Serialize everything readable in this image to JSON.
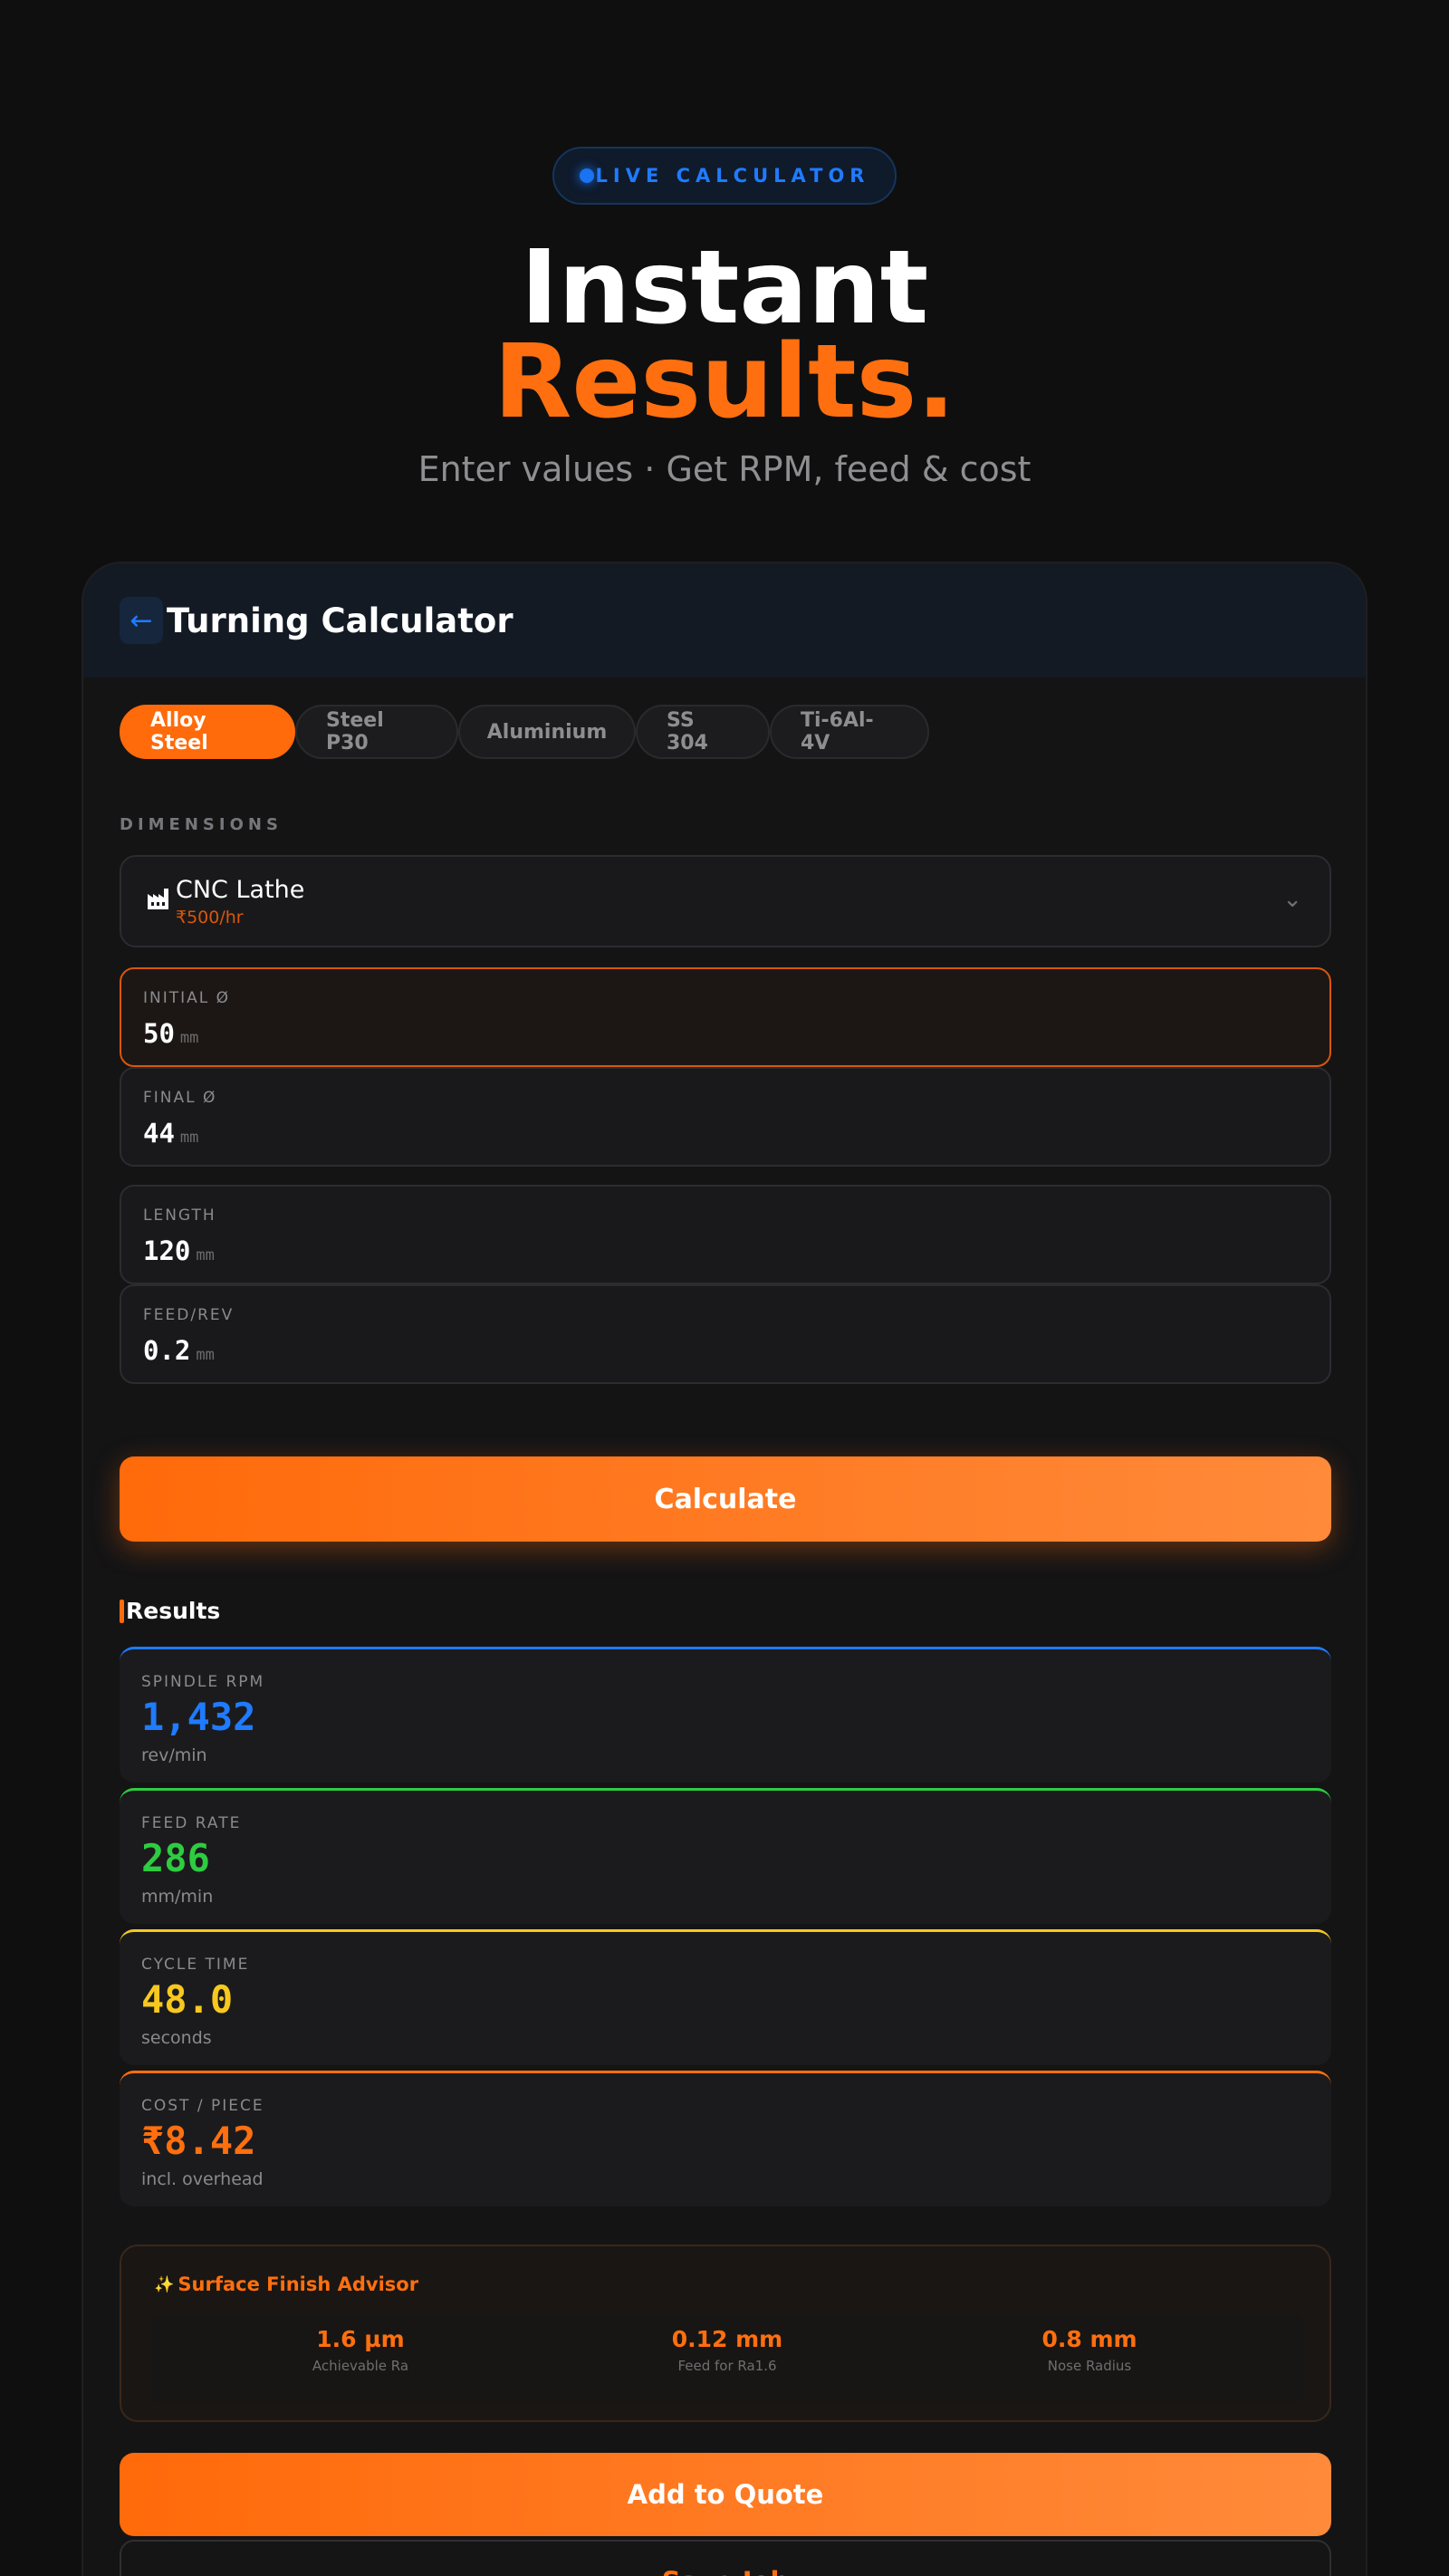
{
  "hero": {
    "badge": "LIVE CALCULATOR",
    "title_line1": "Instant",
    "title_line2": "Results.",
    "subtitle": "Enter values · Get RPM, feed & cost"
  },
  "card": {
    "back_icon": "←",
    "title": "Turning Calculator",
    "materials": [
      {
        "label": "Alloy Steel",
        "active": true
      },
      {
        "label": "Steel P30",
        "active": false
      },
      {
        "label": "Aluminium",
        "active": false
      },
      {
        "label": "SS 304",
        "active": false
      },
      {
        "label": "Ti-6Al-4V",
        "active": false
      }
    ],
    "section_label": "DIMENSIONS",
    "machine": {
      "icon": "factory-icon",
      "name": "CNC Lathe",
      "rate": "₹500/hr",
      "chevron": "⌄"
    },
    "fields": {
      "initial_diameter": {
        "label": "INITIAL Ø",
        "value": "50",
        "unit": "mm"
      },
      "final_diameter": {
        "label": "FINAL Ø",
        "value": "44",
        "unit": "mm"
      },
      "length": {
        "label": "LENGTH",
        "value": "120",
        "unit": "mm"
      },
      "feed_rev": {
        "label": "FEED/REV",
        "value": "0.2",
        "unit": "mm"
      }
    },
    "calculate_label": "Calculate",
    "results_title": "Results",
    "results": {
      "rpm": {
        "label": "SPINDLE RPM",
        "value": "1,432",
        "unit": "rev/min",
        "color": "#1f7bff"
      },
      "feed": {
        "label": "FEED RATE",
        "value": "286",
        "unit": "mm/min",
        "color": "#2ecc40"
      },
      "cycle": {
        "label": "CYCLE TIME",
        "value": "48.0",
        "unit": "seconds",
        "color": "#f7c81e"
      },
      "cost": {
        "label": "COST / PIECE",
        "value": "₹8.42",
        "unit": "incl. overhead",
        "color": "#ff6f0f"
      }
    },
    "advisor": {
      "icon": "sparkle-icon",
      "title": "Surface Finish Advisor",
      "stats": [
        {
          "value": "1.6 µm",
          "label": "Achievable Ra"
        },
        {
          "value": "0.12 mm",
          "label": "Feed for Ra1.6"
        },
        {
          "value": "0.8 mm",
          "label": "Nose Radius"
        }
      ]
    },
    "add_to_quote_label": "Add to Quote",
    "save_job_label": "Save Job"
  }
}
